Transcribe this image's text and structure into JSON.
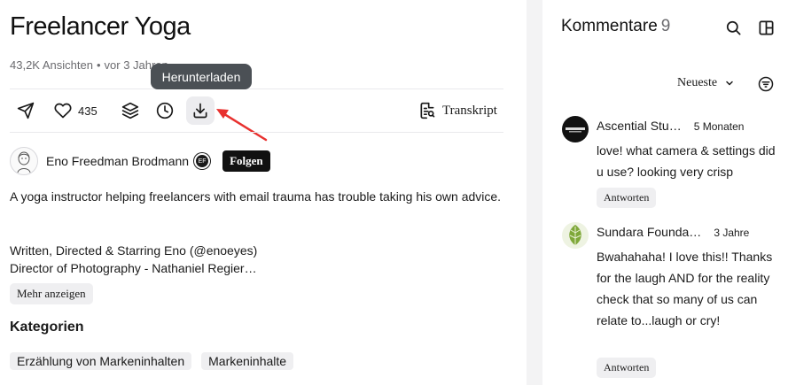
{
  "video": {
    "title": "Freelancer Yoga",
    "views": "43,2K Ansichten",
    "separator": "•",
    "age": "vor 3 Jahren",
    "likes": "435",
    "transcript_label": "Transkript",
    "tooltip": "Herunterladen"
  },
  "author": {
    "name": "Eno Freedman Brodmann",
    "badge": "EF",
    "follow_label": "Folgen"
  },
  "description": {
    "text": "A yoga instructor helping freelancers with email trauma has trouble taking his own advice.",
    "credits": [
      "Written, Directed & Starring Eno (@enoeyes)",
      "Director of Photography - Nathaniel Regier…"
    ],
    "more_label": "Mehr anzeigen"
  },
  "categories": {
    "heading": "Kategorien",
    "tags": [
      "Erzählung von Markeninhalten",
      "Markeninhalte"
    ]
  },
  "comments": {
    "title": "Kommentare",
    "count": "9",
    "sort_label": "Neueste",
    "items": [
      {
        "author": "Ascential Stu…",
        "time": "5 Monaten",
        "text": "love! what camera & settings did u use? looking very crisp",
        "reply_label": "Antworten"
      },
      {
        "author": "Sundara Founda…",
        "time": "3 Jahre",
        "text": "Bwahahaha! I love this!! Thanks for the laugh AND for the reality check that so many of us can relate to...laugh or cry!",
        "reply_label": "Antworten"
      }
    ]
  },
  "icons": {
    "share": "share-icon",
    "like": "heart-icon",
    "collections": "layers-icon",
    "watch_later": "clock-icon",
    "download": "download-icon",
    "transcript": "transcript-icon",
    "search": "search-icon",
    "panel": "panel-toggle-icon",
    "sort": "chevron-down-icon",
    "filter": "filter-icon"
  },
  "colors": {
    "annotation_arrow": "#e8312f",
    "tooltip_bg": "#4b5055",
    "follow_bg": "#111111",
    "chip_bg": "#efeff1"
  }
}
